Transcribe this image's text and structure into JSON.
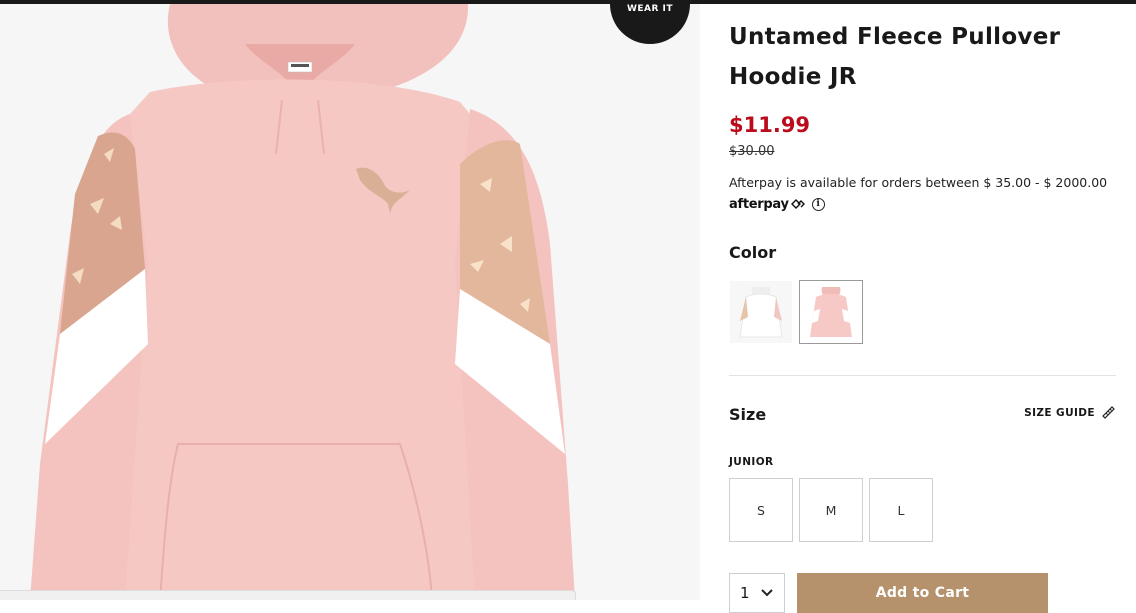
{
  "wear_it": {
    "label": "WEAR IT"
  },
  "image_toast": {
    "text": ""
  },
  "product": {
    "title": "Untamed Fleece Pullover Hoodie JR",
    "sale_price": "$11.99",
    "original_price": "$30.00",
    "afterpay_text": "Afterpay is available for orders between $ 35.00 - $ 2000.00",
    "afterpay_logo": "afterpay"
  },
  "color": {
    "label": "Color",
    "swatches": [
      {
        "name": "white",
        "selected": false,
        "hex": "#f4f4f4"
      },
      {
        "name": "pink",
        "selected": true,
        "hex": "#f6c9c6"
      }
    ]
  },
  "size": {
    "label": "Size",
    "guide_label": "SIZE GUIDE",
    "group_label": "JUNIOR",
    "options": [
      "S",
      "M",
      "L"
    ]
  },
  "cart": {
    "quantity": "1",
    "add_label": "Add to Cart"
  },
  "colors": {
    "sale_red": "#ba0c1a",
    "add_to_cart_bg": "#b5926c",
    "hoodie_pink": "#f6c9c6",
    "topbar": "#191919"
  }
}
